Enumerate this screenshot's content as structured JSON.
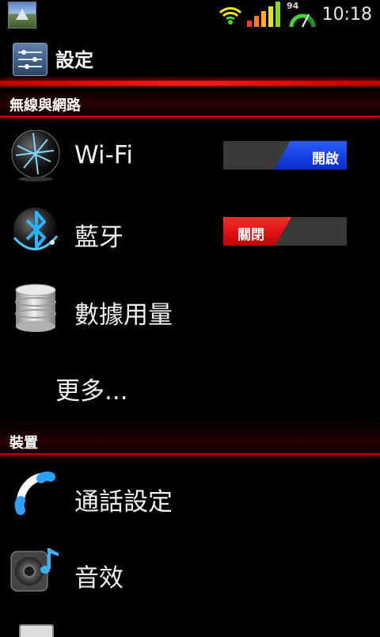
{
  "status_bar": {
    "battery_percent": "94",
    "clock": "10:18"
  },
  "action_bar": {
    "title": "設定"
  },
  "sections": [
    {
      "header": "無線與網路",
      "items": [
        {
          "label": "Wi-Fi",
          "icon": "wifi-globe-icon",
          "toggle": "開啟",
          "toggle_state": "on"
        },
        {
          "label": "藍牙",
          "icon": "bluetooth-icon",
          "toggle": "關閉",
          "toggle_state": "off"
        },
        {
          "label": "數據用量",
          "icon": "data-usage-icon"
        },
        {
          "label": "更多..."
        }
      ]
    },
    {
      "header": "裝置",
      "items": [
        {
          "label": "通話設定",
          "icon": "phone-handset-icon"
        },
        {
          "label": "音效",
          "icon": "speaker-note-icon"
        }
      ]
    }
  ],
  "colors": {
    "accent_red": "#e00000",
    "toggle_on_blue": "#1a48f0",
    "toggle_off_red": "#e01010"
  }
}
